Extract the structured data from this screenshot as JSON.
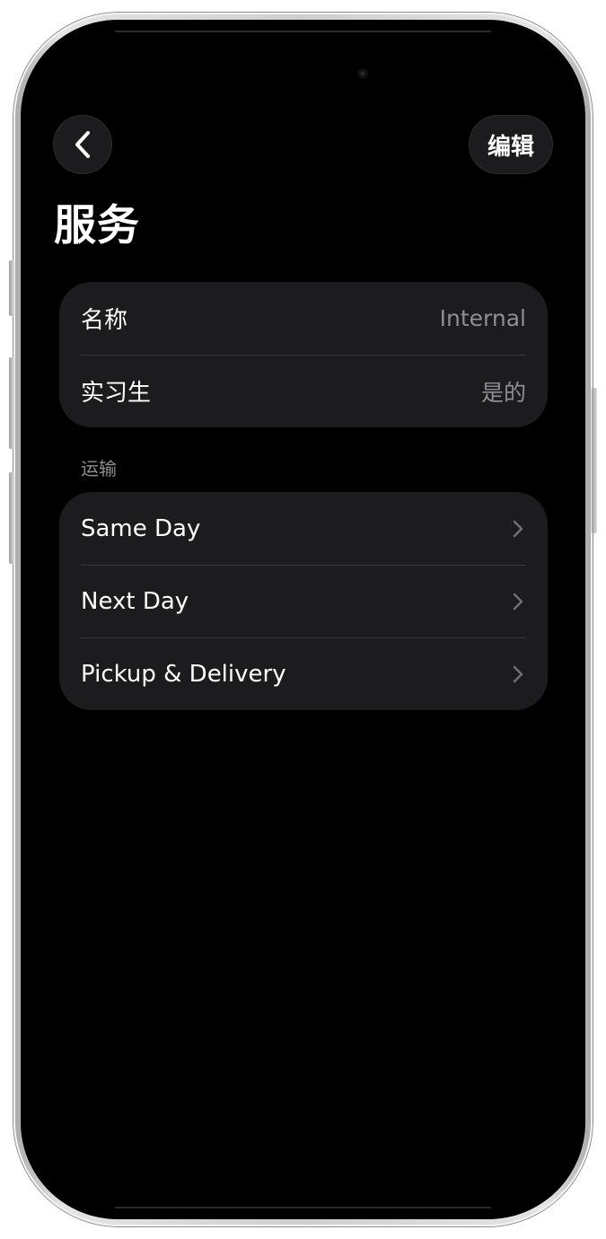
{
  "nav": {
    "back_icon": "chevron-left-icon",
    "edit_label": "编辑"
  },
  "page": {
    "title": "服务"
  },
  "info_group": {
    "rows": [
      {
        "label": "名称",
        "value": "Internal"
      },
      {
        "label": "实习生",
        "value": "是的"
      }
    ]
  },
  "shipping_section": {
    "header": "运输",
    "rows": [
      {
        "label": "Same Day",
        "icon": "chevron-right-icon"
      },
      {
        "label": "Next Day",
        "icon": "chevron-right-icon"
      },
      {
        "label": "Pickup & Delivery",
        "icon": "chevron-right-icon"
      }
    ]
  },
  "colors": {
    "background": "#000000",
    "group_background": "#1c1c1e",
    "secondary_text": "#8e8e93",
    "separator": "#38383a"
  }
}
